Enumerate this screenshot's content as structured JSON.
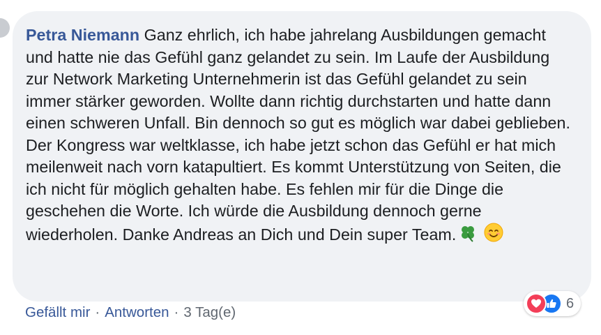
{
  "comment": {
    "author": "Petra Niemann",
    "text": "Ganz ehrlich, ich habe jahrelang Ausbildungen gemacht und hatte nie das Gefühl ganz gelandet zu sein. Im Laufe der Ausbildung zur Network Marketing Unternehmerin ist das Gefühl gelandet zu sein immer stärker geworden. Wollte dann richtig durchstarten und hatte dann einen schweren Unfall. Bin dennoch so gut es möglich war dabei geblieben. Der Kongress war weltklasse, ich habe jetzt schon das Gefühl er hat mich meilenweit nach vorn katapultiert. Es kommt Unterstützung von Seiten, die ich nicht für möglich gehalten habe. Es fehlen mir für die Dinge die geschehen die Worte. Ich würde die Ausbildung dennoch gerne wiederholen. Danke Andreas an Dich und Dein super Team.",
    "emojis": [
      "four-leaf-clover-icon",
      "smiling-face-icon"
    ]
  },
  "actions": {
    "like_label": "Gefällt mir",
    "reply_label": "Antworten",
    "separator": "·",
    "timestamp": "3 Tag(e)"
  },
  "reactions": {
    "types": [
      "love-reaction-icon",
      "like-reaction-icon"
    ],
    "count": "6",
    "colors": {
      "love": "#f33e58",
      "like": "#1877f2"
    }
  },
  "colors": {
    "bubble": "#f0f2f5",
    "author": "#385898",
    "text": "#1c1e21",
    "meta": "#606770"
  }
}
